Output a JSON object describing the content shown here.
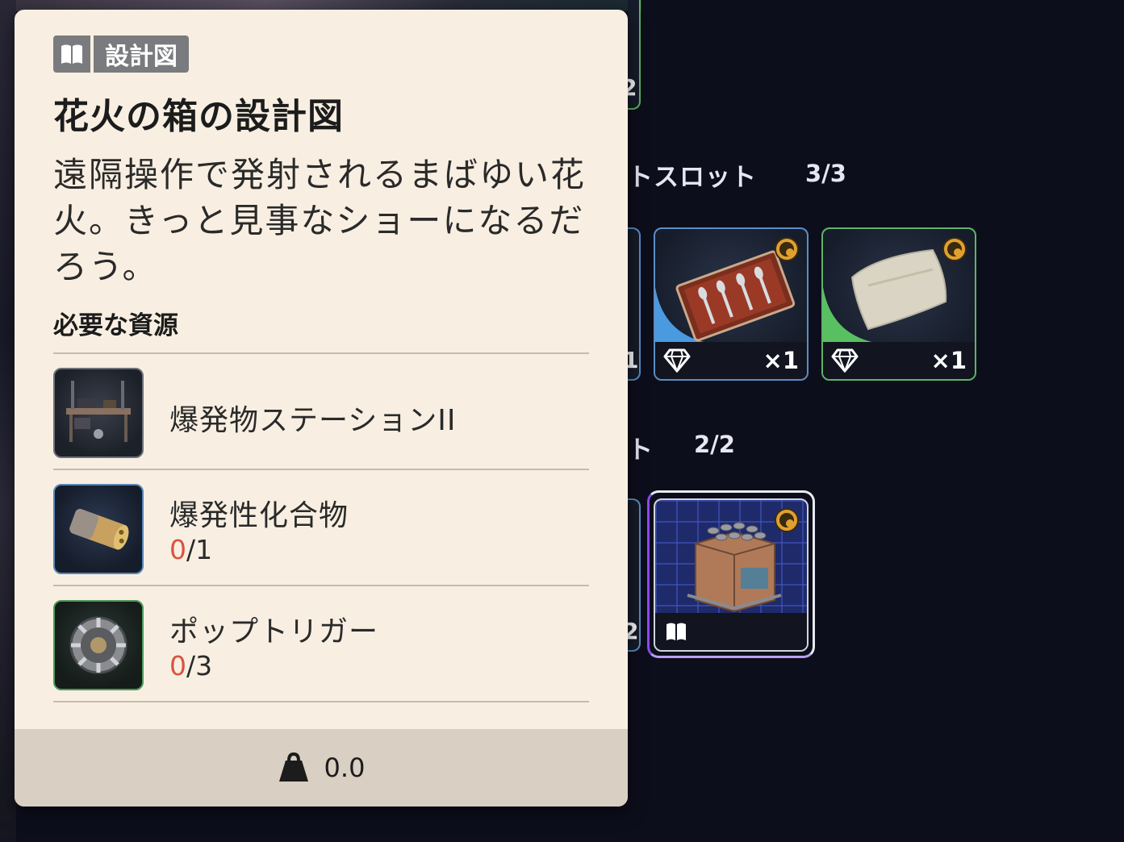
{
  "tooltip": {
    "type_label": "設計図",
    "title": "花火の箱の設計図",
    "description": "遠隔操作で発射されるまばゆい花火。きっと見事なショーになるだろう。",
    "requirements_heading": "必要な資源",
    "requirements": [
      {
        "name": "爆発物ステーションII",
        "icon": "workbench-icon"
      },
      {
        "name": "爆発性化合物",
        "have": "0",
        "need": "/1",
        "icon": "explosive-compound-icon"
      },
      {
        "name": "ポップトリガー",
        "have": "0",
        "need": "/3",
        "icon": "pop-trigger-icon"
      }
    ],
    "weight": "0.0",
    "colors": {
      "panel": "#f8efe2",
      "footer": "#d9cfc2",
      "missing_count": "#d9533f"
    }
  },
  "inventory": {
    "section1": {
      "title_fragment": "トスロット",
      "count": "3/3"
    },
    "section2": {
      "title_fragment": "ト",
      "count": "2/2"
    },
    "slots": [
      {
        "item": "silverware-case",
        "quantity": "×1",
        "rarity": "blue",
        "icons": [
          "gem-icon",
          "badge-icon"
        ]
      },
      {
        "item": "pillow",
        "quantity": "×1",
        "rarity": "green",
        "icons": [
          "gem-icon",
          "badge-icon"
        ]
      },
      {
        "item": "fireworks-box-blueprint",
        "rarity": "purple",
        "icons": [
          "blueprint-icon",
          "badge-icon"
        ]
      }
    ],
    "partial_quantities": [
      "1",
      "2",
      "2"
    ]
  }
}
